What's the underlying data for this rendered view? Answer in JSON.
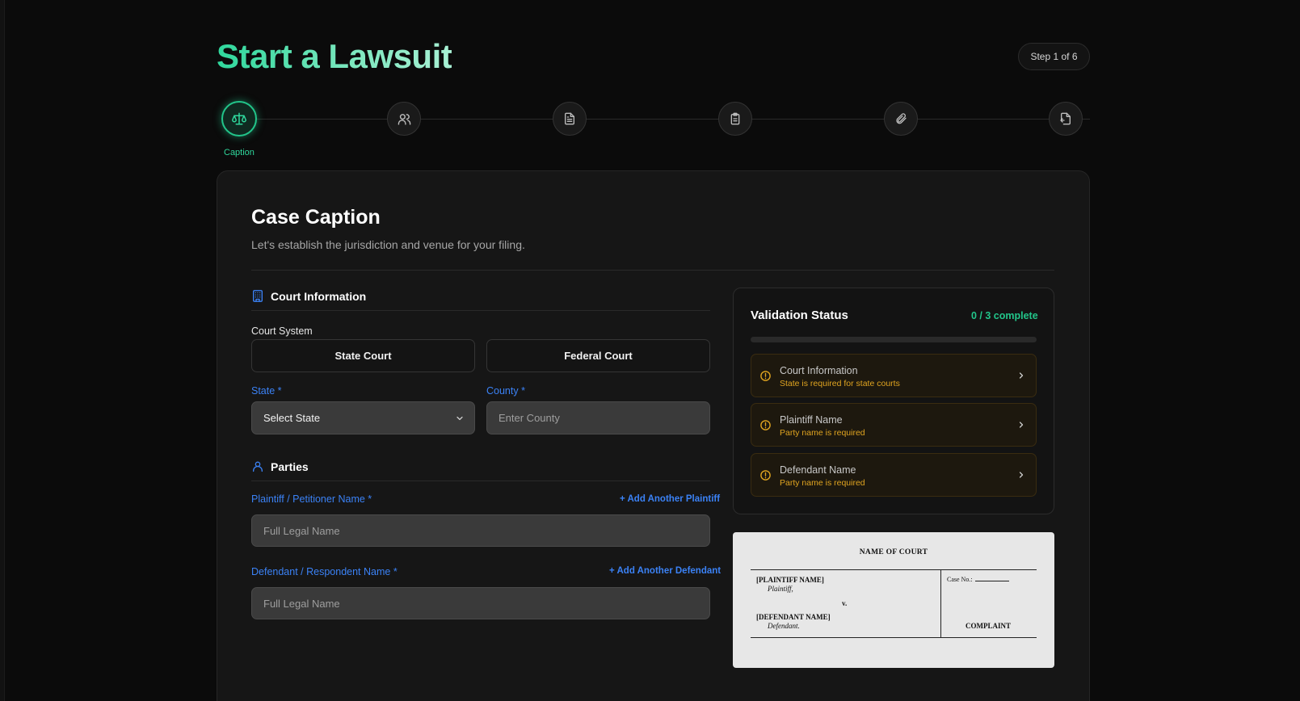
{
  "header": {
    "title": "Start a Lawsuit",
    "step_indicator": "Step 1 of 6"
  },
  "stepper": {
    "steps": [
      {
        "icon": "scale-icon",
        "label": "Caption",
        "active": true
      },
      {
        "icon": "users-icon",
        "label": "",
        "active": false
      },
      {
        "icon": "document-icon",
        "label": "",
        "active": false
      },
      {
        "icon": "clipboard-icon",
        "label": "",
        "active": false
      },
      {
        "icon": "paperclip-icon",
        "label": "",
        "active": false
      },
      {
        "icon": "file-export-icon",
        "label": "",
        "active": false
      }
    ]
  },
  "caption": {
    "title": "Case Caption",
    "subtitle": "Let's establish the jurisdiction and venue for your filing."
  },
  "court_info": {
    "heading": "Court Information",
    "court_system_label": "Court System",
    "state_court_label": "State Court",
    "federal_court_label": "Federal Court",
    "state_label": "State",
    "state_value": "Select State",
    "county_label": "County",
    "county_placeholder": "Enter County",
    "required_mark": "*"
  },
  "parties": {
    "heading": "Parties",
    "plaintiff_label": "Plaintiff / Petitioner Name",
    "add_plaintiff": "+ Add Another Plaintiff",
    "plaintiff_placeholder": "Full Legal Name",
    "defendant_label": "Defendant / Respondent Name",
    "add_defendant": "+ Add Another Defendant",
    "defendant_placeholder": "Full Legal Name"
  },
  "validation": {
    "title": "Validation Status",
    "count": "0 / 3 complete",
    "progress_fraction": 0,
    "items": [
      {
        "title": "Court Information",
        "message": "State is required for state courts"
      },
      {
        "title": "Plaintiff Name",
        "message": "Party name is required"
      },
      {
        "title": "Defendant Name",
        "message": "Party name is required"
      }
    ],
    "colors": {
      "accent": "#22c58a",
      "warning": "#e0a420"
    }
  },
  "preview": {
    "court": "NAME OF COURT",
    "plaintiff": "[PLAINTIFF NAME]",
    "plaintiff_role": "Plaintiff,",
    "versus": "v.",
    "defendant": "[DEFENDANT NAME]",
    "defendant_role": "Defendant.",
    "case_no": "Case No.:",
    "doc_type": "COMPLAINT"
  }
}
